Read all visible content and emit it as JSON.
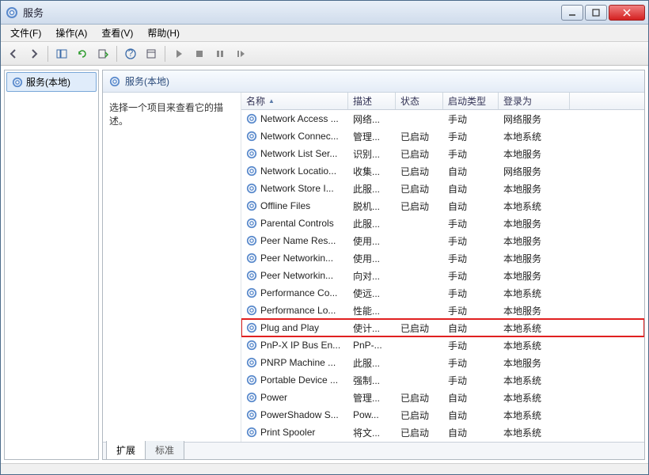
{
  "titlebar": {
    "title": "服务"
  },
  "menubar": {
    "file": "文件(F)",
    "action": "操作(A)",
    "view": "查看(V)",
    "help": "帮助(H)"
  },
  "tree": {
    "root": "服务(本地)"
  },
  "content": {
    "header": "服务(本地)",
    "detail_prompt": "选择一个项目来查看它的描述。"
  },
  "columns": {
    "name": "名称",
    "desc": "描述",
    "status": "状态",
    "startup": "启动类型",
    "logon": "登录为"
  },
  "services": [
    {
      "name": "Network Access ...",
      "desc": "网络...",
      "status": "",
      "startup": "手动",
      "logon": "网络服务"
    },
    {
      "name": "Network Connec...",
      "desc": "管理...",
      "status": "已启动",
      "startup": "手动",
      "logon": "本地系统"
    },
    {
      "name": "Network List Ser...",
      "desc": "识别...",
      "status": "已启动",
      "startup": "手动",
      "logon": "本地服务"
    },
    {
      "name": "Network Locatio...",
      "desc": "收集...",
      "status": "已启动",
      "startup": "自动",
      "logon": "网络服务"
    },
    {
      "name": "Network Store I...",
      "desc": "此服...",
      "status": "已启动",
      "startup": "自动",
      "logon": "本地服务"
    },
    {
      "name": "Offline Files",
      "desc": "脱机...",
      "status": "已启动",
      "startup": "自动",
      "logon": "本地系统"
    },
    {
      "name": "Parental Controls",
      "desc": "此服...",
      "status": "",
      "startup": "手动",
      "logon": "本地服务"
    },
    {
      "name": "Peer Name Res...",
      "desc": "使用...",
      "status": "",
      "startup": "手动",
      "logon": "本地服务"
    },
    {
      "name": "Peer Networkin...",
      "desc": "使用...",
      "status": "",
      "startup": "手动",
      "logon": "本地服务"
    },
    {
      "name": "Peer Networkin...",
      "desc": "向对...",
      "status": "",
      "startup": "手动",
      "logon": "本地服务"
    },
    {
      "name": "Performance Co...",
      "desc": "使远...",
      "status": "",
      "startup": "手动",
      "logon": "本地系统"
    },
    {
      "name": "Performance Lo...",
      "desc": "性能...",
      "status": "",
      "startup": "手动",
      "logon": "本地服务"
    },
    {
      "name": "Plug and Play",
      "desc": "使计...",
      "status": "已启动",
      "startup": "自动",
      "logon": "本地系统",
      "highlighted": true
    },
    {
      "name": "PnP-X IP Bus En...",
      "desc": "PnP-...",
      "status": "",
      "startup": "手动",
      "logon": "本地系统"
    },
    {
      "name": "PNRP Machine ...",
      "desc": "此服...",
      "status": "",
      "startup": "手动",
      "logon": "本地服务"
    },
    {
      "name": "Portable Device ...",
      "desc": "强制...",
      "status": "",
      "startup": "手动",
      "logon": "本地系统"
    },
    {
      "name": "Power",
      "desc": "管理...",
      "status": "已启动",
      "startup": "自动",
      "logon": "本地系统"
    },
    {
      "name": "PowerShadow S...",
      "desc": "Pow...",
      "status": "已启动",
      "startup": "自动",
      "logon": "本地系统"
    },
    {
      "name": "Print Spooler",
      "desc": "将文...",
      "status": "已启动",
      "startup": "自动",
      "logon": "本地系统"
    }
  ],
  "tabs": {
    "extended": "扩展",
    "standard": "标准"
  }
}
